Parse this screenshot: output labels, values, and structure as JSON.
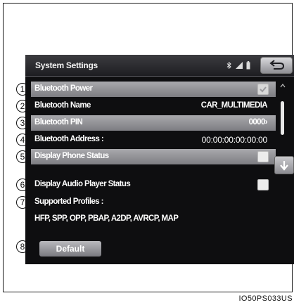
{
  "window": {
    "title": "System Settings",
    "status_icons": [
      "bluetooth-icon",
      "signal-icon",
      "battery-icon"
    ],
    "back_icon": "return-arrow-icon"
  },
  "settings": {
    "rows": [
      {
        "callout": "1",
        "label": "Bluetooth Power",
        "type": "checkbox",
        "checked": true
      },
      {
        "callout": "2",
        "label": "Bluetooth Name",
        "value": "CAR_MULTIMEDIA"
      },
      {
        "callout": "3",
        "label": "Bluetooth PIN",
        "value": "0000›"
      },
      {
        "callout": "4",
        "label": "Bluetooth Address :",
        "value": "00:00:00:00:00:00"
      },
      {
        "callout": "5",
        "label": "Display Phone Status",
        "type": "checkbox",
        "checked": false
      },
      {
        "callout": "6",
        "label": "Display Audio Player Status",
        "type": "checkbox",
        "checked": false
      },
      {
        "callout": "7",
        "label": "Supported Profiles :"
      },
      {
        "label": "HFP, SPP, OPP, PBAP, A2DP, AVRCP, MAP"
      }
    ]
  },
  "default_button": {
    "callout": "8",
    "label": "Default"
  },
  "colors": {
    "screen_bg": "#0e0e10",
    "row_highlight": "#9a9a9e",
    "text": "#ffffff"
  },
  "image_code": "IO50PS033US"
}
